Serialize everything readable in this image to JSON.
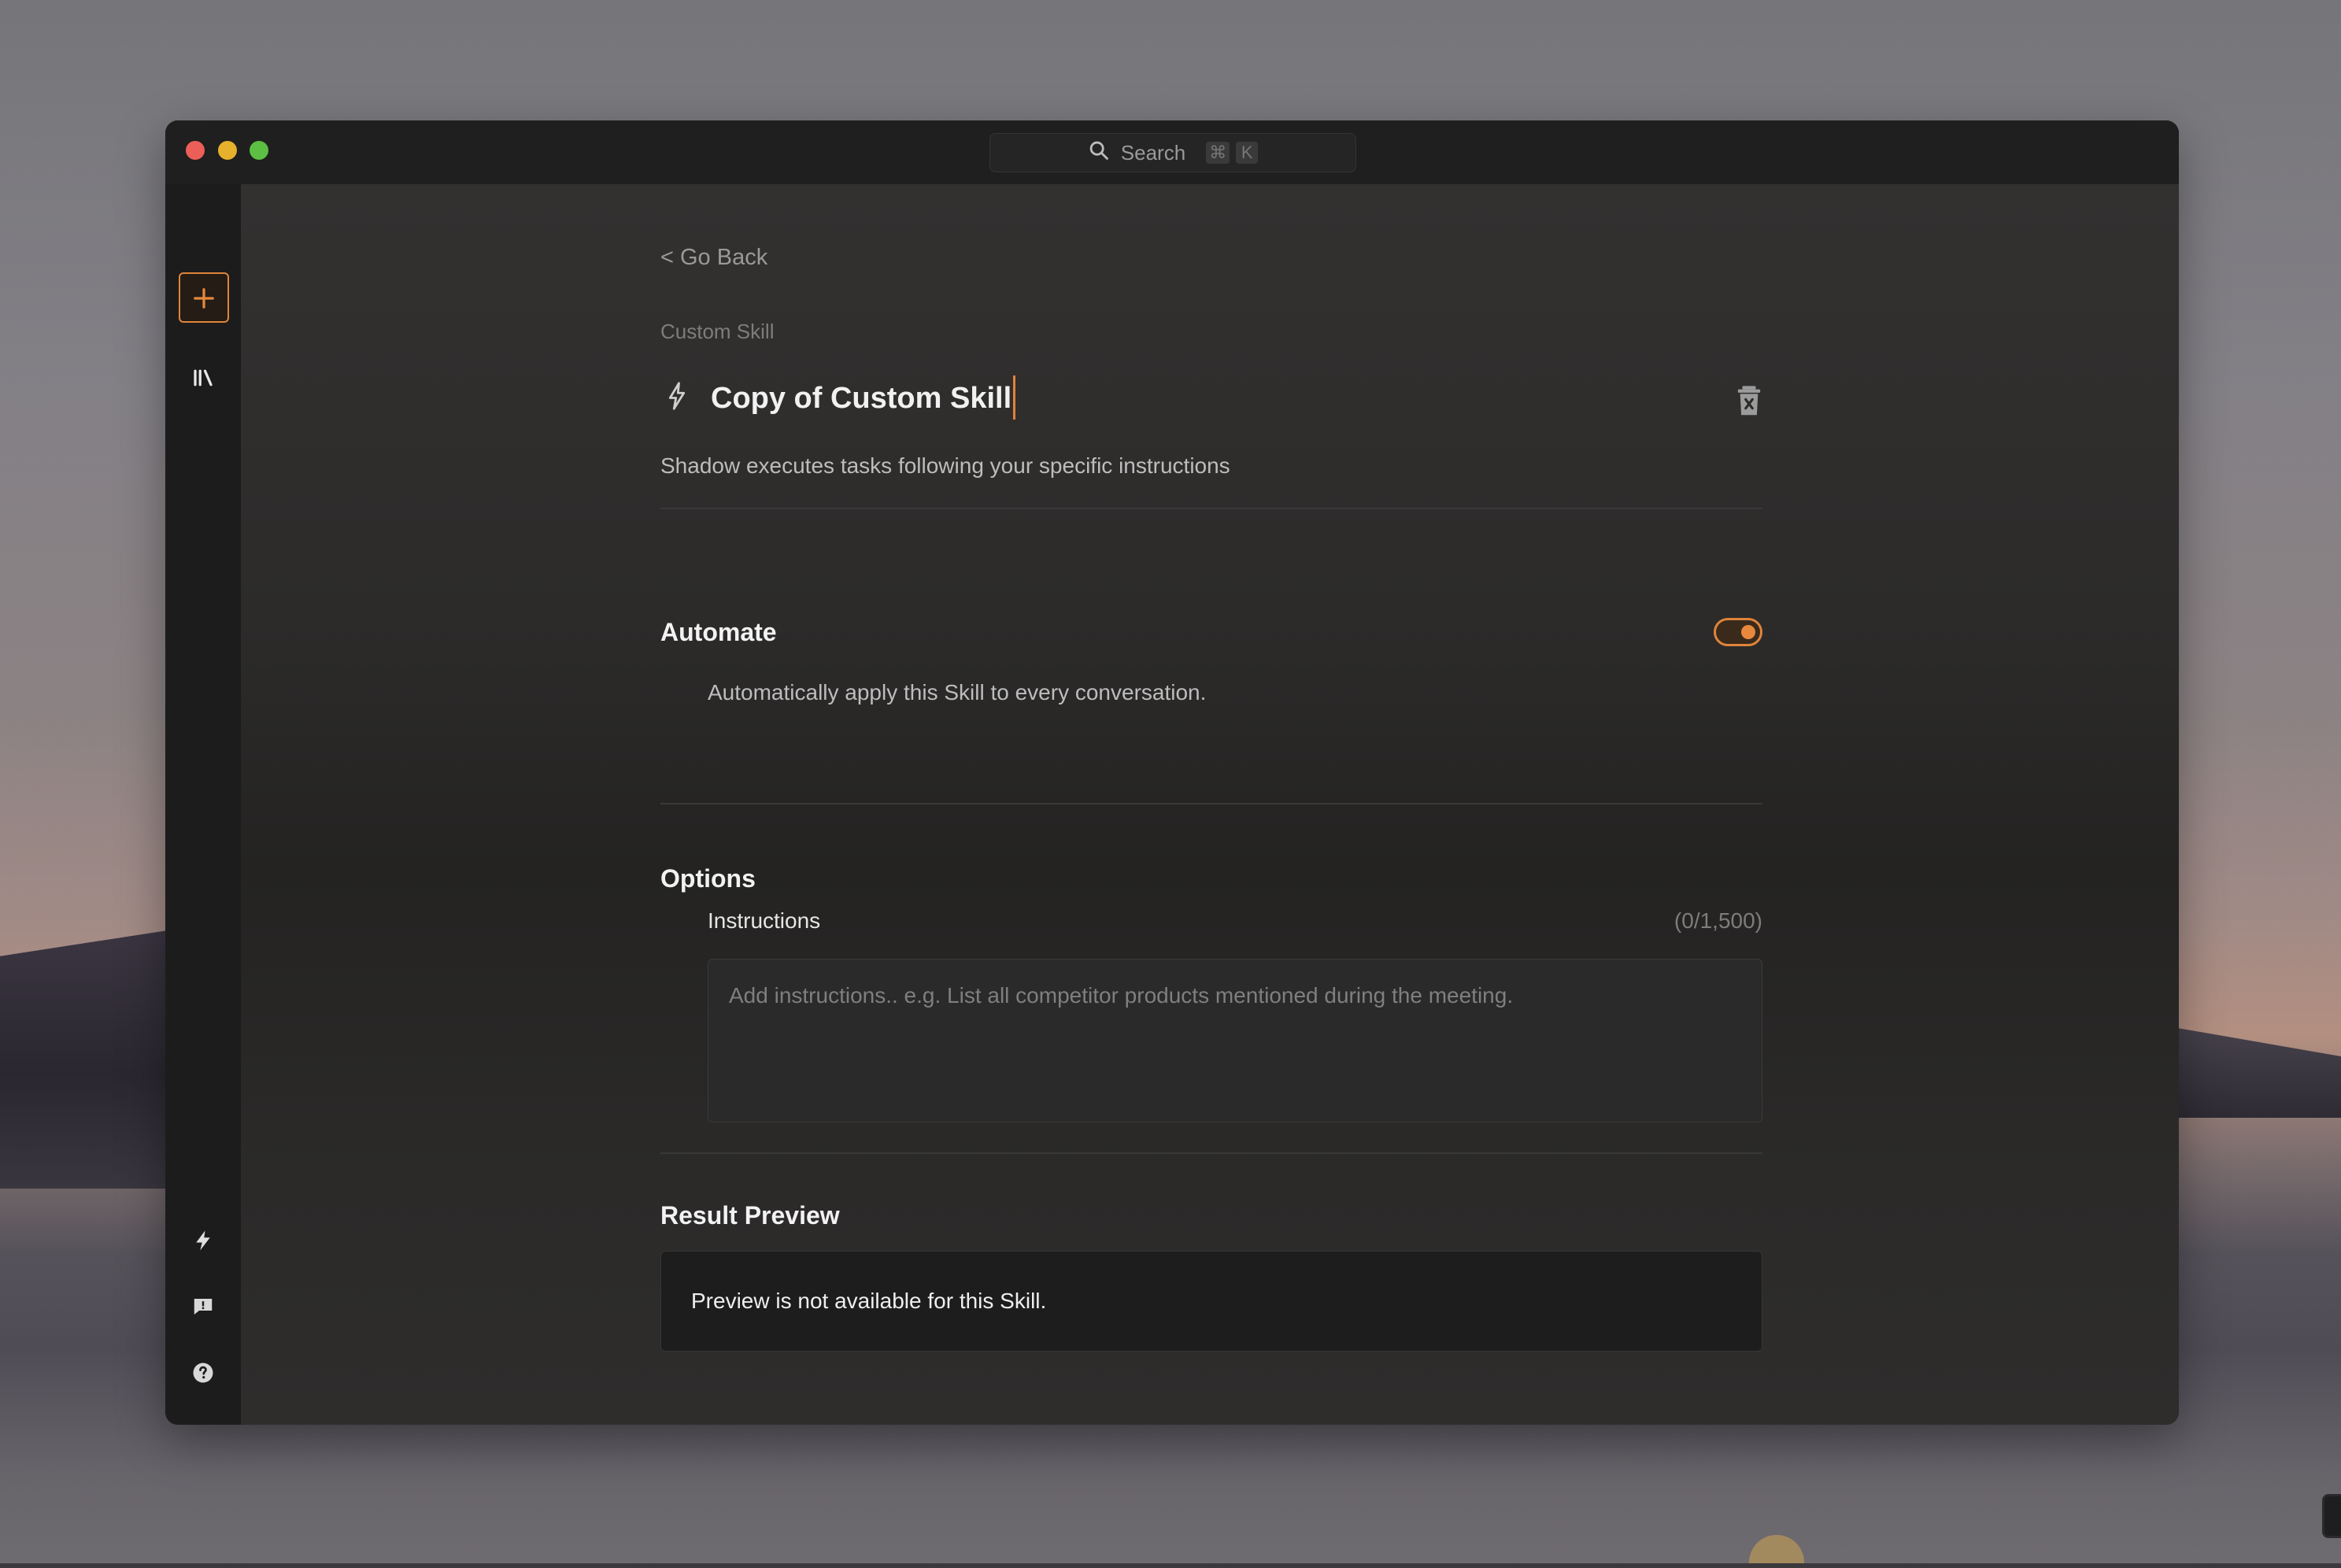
{
  "search": {
    "label": "Search",
    "shortcut_keys": [
      "⌘",
      "K"
    ]
  },
  "sidebar": {
    "new_icon": "plus-icon",
    "items": [
      {
        "icon": "library-icon"
      },
      {
        "icon": "bolt-icon"
      },
      {
        "icon": "feedback-icon"
      },
      {
        "icon": "help-icon"
      },
      {
        "icon": "gear-icon"
      }
    ]
  },
  "page": {
    "go_back": "< Go Back",
    "eyebrow": "Custom Skill",
    "title": "Copy of Custom Skill",
    "subtitle": "Shadow executes tasks following your specific instructions"
  },
  "automate": {
    "heading": "Automate",
    "description": "Automatically apply this Skill to every conversation.",
    "enabled": true
  },
  "options": {
    "heading": "Options",
    "instructions_label": "Instructions",
    "instructions_count": "(0/1,500)",
    "instructions_placeholder": "Add instructions.. e.g. List all competitor products mentioned during the meeting.",
    "instructions_value": ""
  },
  "preview": {
    "heading": "Result Preview",
    "text": "Preview is not available for this Skill."
  },
  "colors": {
    "accent": "#e0843a",
    "window_bg": "#2a2929",
    "titlebar_bg": "#1f1f1f",
    "sidebar_bg": "#1c1c1c"
  }
}
